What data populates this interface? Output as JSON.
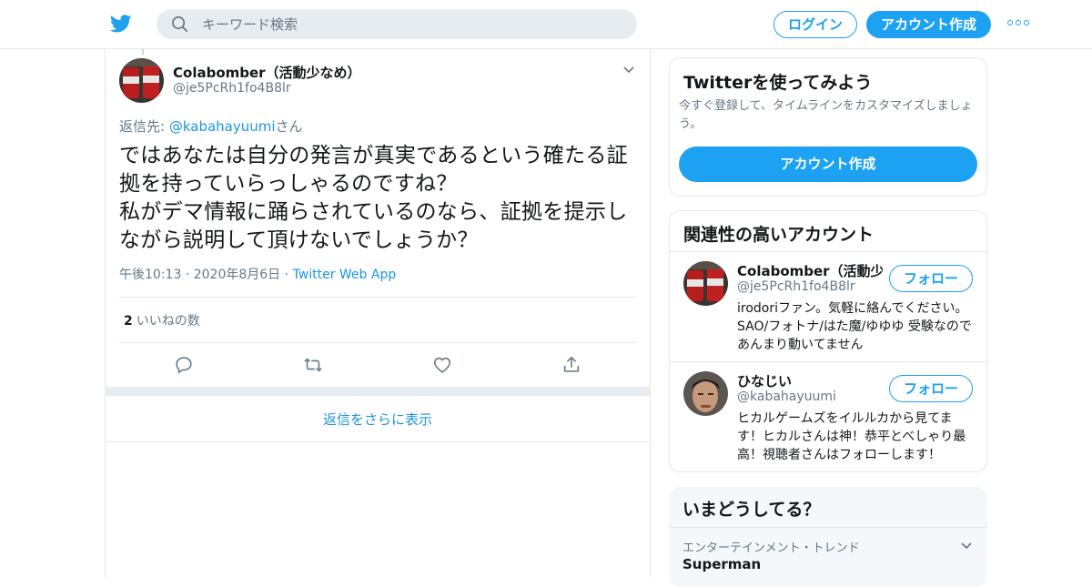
{
  "header": {
    "search_placeholder": "キーワード検索",
    "login_label": "ログイン",
    "signup_label": "アカウント作成",
    "icons": [
      "twitter-logo-icon",
      "search-icon",
      "more-icon"
    ],
    "accent_color": "#1da1f2"
  },
  "tweet": {
    "author_name": "Colabomber（活動少なめ）",
    "author_handle": "@je5PcRh1fo4B8lr",
    "reply_prefix": "返信先: ",
    "reply_handle": "@kabahayuumi",
    "reply_suffix": "さん",
    "text_lines": [
      "ではあなたは自分の発言が真実であるという確たる証",
      "拠を持っていらっしゃるのですね？",
      "私がデマ情報に踊らされているのなら、証拠を提示し",
      "ながら説明して頂けないでしょうか？"
    ],
    "time": "午後10:13",
    "date": "2020年8月6日",
    "app": "Twitter Web App",
    "sep": "·",
    "like_count": "2",
    "like_label": "いいねの数",
    "actions": [
      "reply-icon",
      "retweet-icon",
      "like-icon",
      "share-icon"
    ],
    "more_replies_label": "返信をさらに表示"
  },
  "signup_card": {
    "title": "Twitterを使ってみよう",
    "subtitle": "今すぐ登録して、タイムラインをカスタマイズしましょう。",
    "button_label": "アカウント作成"
  },
  "related": {
    "title": "関連性の高いアカウント",
    "follow_label": "フォロー",
    "accounts": [
      {
        "name": "Colabomber（活動少...",
        "handle": "@je5PcRh1fo4B8lr",
        "bio": "irodoriファン。気軽に絡んでください。 SAO/フォトナ/はた魔/ゆゆゆ 受験なのであんまり動いてません"
      },
      {
        "name": "ひなじい",
        "handle": "@kabahayuumi",
        "bio": "ヒカルゲームズをイルルカから見てます！ヒカルさんは神！恭平とべしゃり最高！視聴者さんはフォローします！"
      }
    ]
  },
  "trends": {
    "title": "いまどうしてる？",
    "category": "エンターテインメント・トレンド",
    "first_trend": "Superman"
  }
}
